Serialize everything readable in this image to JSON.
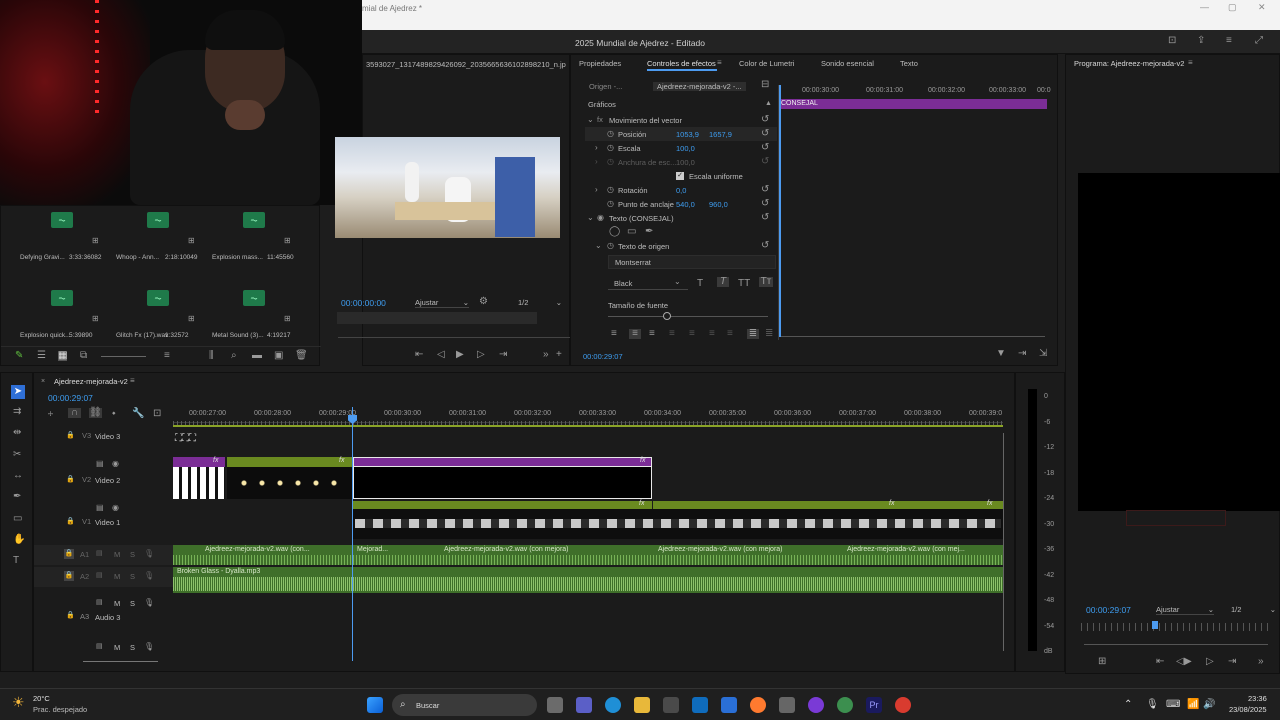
{
  "window": {
    "title": "mial de Ajedrez *",
    "app_title": "2025 Mundial de Ajedrez - Editado"
  },
  "source_monitor": {
    "filename": "3593027_1317489829426092_2035665636102898210_n.jpg",
    "timecode": "00:00:00:00",
    "fit": "Ajustar",
    "resolution": "1/2"
  },
  "project_bin": {
    "items": [
      {
        "name": "Defying Gravi...",
        "duration": "3:33:36082"
      },
      {
        "name": "Whoop - Ann...",
        "duration": "2:18:10049"
      },
      {
        "name": "Explosion mass...",
        "duration": "11:45560"
      },
      {
        "name": "Explosion quick...",
        "duration": "5:39890"
      },
      {
        "name": "Glitch Fx (17).wav",
        "duration": "1:32572"
      },
      {
        "name": "Metal Sound (3)...",
        "duration": "4:19217"
      }
    ]
  },
  "effects_panel": {
    "tabs": [
      "Propiedades",
      "Controles de efectos",
      "Color de Lumetri",
      "Sonido esencial",
      "Texto"
    ],
    "active_tab": "Controles de efectos",
    "source_label": "Origen -...",
    "sequence_label": "Ajedreez-mejorada-v2 -...",
    "section": "Gráficos",
    "vector_motion": "Movimiento del vector",
    "position_label": "Posición",
    "position_x": "1053,9",
    "position_y": "1657,9",
    "scale_label": "Escala",
    "scale_value": "100,0",
    "width_label": "Anchura de esc...",
    "width_value": "100,0",
    "uniform_scale": "Escala uniforme",
    "rotation_label": "Rotación",
    "rotation_value": "0,0",
    "anchor_label": "Punto de anclaje",
    "anchor_x": "540,0",
    "anchor_y": "960,0",
    "text_layer": "Texto (CONSEJAL)",
    "source_text": "Texto de origen",
    "font": "Montserrat",
    "font_style": "Black",
    "font_size_label": "Tamaño de fuente",
    "timecode": "00:00:29:07",
    "mini_clip_label": "CONSEJAL",
    "mini_ruler": [
      "00:00:30:00",
      "00:00:31:00",
      "00:00:32:00",
      "00:00:33:00",
      "00:0"
    ]
  },
  "program_monitor": {
    "title": "Programa: Ajedreez-mejorada-v2",
    "timecode": "00:00:29:07",
    "fit": "Ajustar",
    "resolution": "1/2"
  },
  "timeline": {
    "sequence": "Ajedreez-mejorada-v2",
    "timecode": "00:00:29:07",
    "ruler": [
      "00:00:27:00",
      "00:00:28:00",
      "00:00:29:00",
      "00:00:30:00",
      "00:00:31:00",
      "00:00:32:00",
      "00:00:33:00",
      "00:00:34:00",
      "00:00:35:00",
      "00:00:36:00",
      "00:00:37:00",
      "00:00:38:00",
      "00:00:39:0"
    ],
    "tracks": {
      "v3": "V3",
      "v3_name": "Video 3",
      "v2": "V2",
      "v2_name": "Video 2",
      "v1": "V1",
      "v1_name": "Video 1",
      "a1": "A1",
      "a2": "A2",
      "a3": "A3",
      "a3_name": "Audio 3"
    },
    "audio_clips": [
      "Ajedreez-mejorada-v2.wav (con...",
      "Mejorad...",
      "Ajedreez-mejorada-v2.wav (con mejora)",
      "Ajedreez-mejorada-v2.wav (con mejora)",
      "Ajedreez-mejorada-v2.wav (con mej..."
    ],
    "music_clip": "Broken Glass - Dyalla.mp3",
    "fx": "fx"
  },
  "meter_scale": [
    "0",
    "-6",
    "-12",
    "-18",
    "-24",
    "-30",
    "-36",
    "-42",
    "-48",
    "-54",
    "dB"
  ],
  "taskbar": {
    "weather_temp": "20°C",
    "weather_desc": "Prac. despejado",
    "search": "Buscar",
    "time": "23:36",
    "date": "23/08/2025"
  },
  "colors": {
    "accent": "#4d9bf0",
    "clip_purple": "#7b2d96",
    "clip_green": "#6a8a20",
    "audio_green": "#3f6f2a"
  }
}
